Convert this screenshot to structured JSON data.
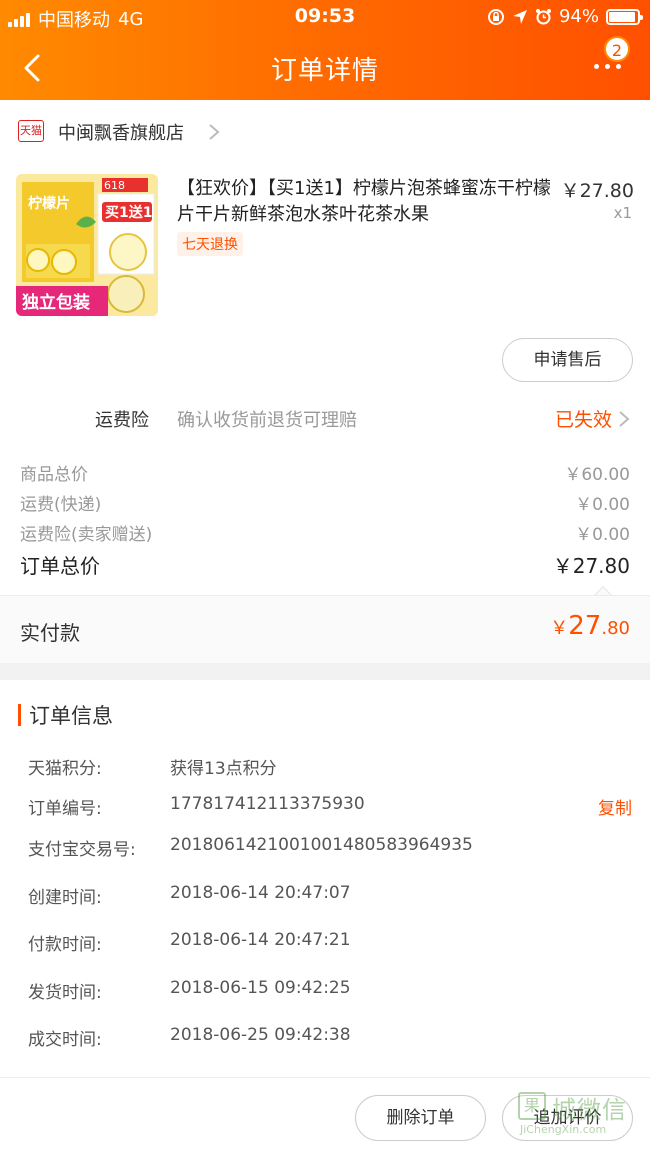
{
  "status_bar": {
    "carrier": "中国移动",
    "network": "4G",
    "time": "09:53",
    "battery": "94%",
    "battery_level": 0.94
  },
  "nav": {
    "title": "订单详情",
    "badge": "2"
  },
  "shop": {
    "badge_text": "天猫",
    "name": "中闽飘香旗舰店"
  },
  "product": {
    "title": "【狂欢价】【买1送1】柠檬片泡茶蜂蜜冻干柠檬片干片新鲜茶泡水茶叶花茶水果",
    "tag": "七天退换",
    "price": "￥27.80",
    "qty": "x1",
    "image_text": {
      "brand": "柠檬片",
      "promo": "买1送1",
      "banner": "独立包装",
      "event": "618"
    }
  },
  "after_sale_button": "申请售后",
  "insurance": {
    "label": "运费险",
    "desc": "确认收货前退货可理赔",
    "status": "已失效"
  },
  "fees": [
    {
      "label": "商品总价",
      "value": "￥60.00"
    },
    {
      "label": "运费(快递)",
      "value": "￥0.00"
    },
    {
      "label": "运费险(卖家赠送)",
      "value": "￥0.00"
    }
  ],
  "order_total": {
    "label": "订单总价",
    "value": "￥27.80"
  },
  "paid": {
    "label": "实付款",
    "currency": "￥",
    "int": "27",
    "dec": ".80"
  },
  "order_info": {
    "title": "订单信息",
    "rows": [
      {
        "label": "天猫积分:",
        "value": "获得13点积分"
      },
      {
        "label": "订单编号:",
        "value": "177817412113375930",
        "action": "复制"
      },
      {
        "label": "支付宝交易号:",
        "value": "2018061421001001480583964935"
      },
      {
        "label": "创建时间:",
        "value": "2018-06-14 20:47:07"
      },
      {
        "label": "付款时间:",
        "value": "2018-06-14 20:47:21"
      },
      {
        "label": "发货时间:",
        "value": "2018-06-15 09:42:25"
      },
      {
        "label": "成交时间:",
        "value": "2018-06-25 09:42:38"
      }
    ]
  },
  "bottom_buttons": {
    "delete": "删除订单",
    "review": "追加评价"
  },
  "watermark": {
    "box": "果",
    "text": "城微信",
    "sub": "JiChengXin.com"
  },
  "colors": {
    "accent": "#ff5000",
    "header_start": "#ff8a00",
    "header_end": "#ff5000"
  }
}
